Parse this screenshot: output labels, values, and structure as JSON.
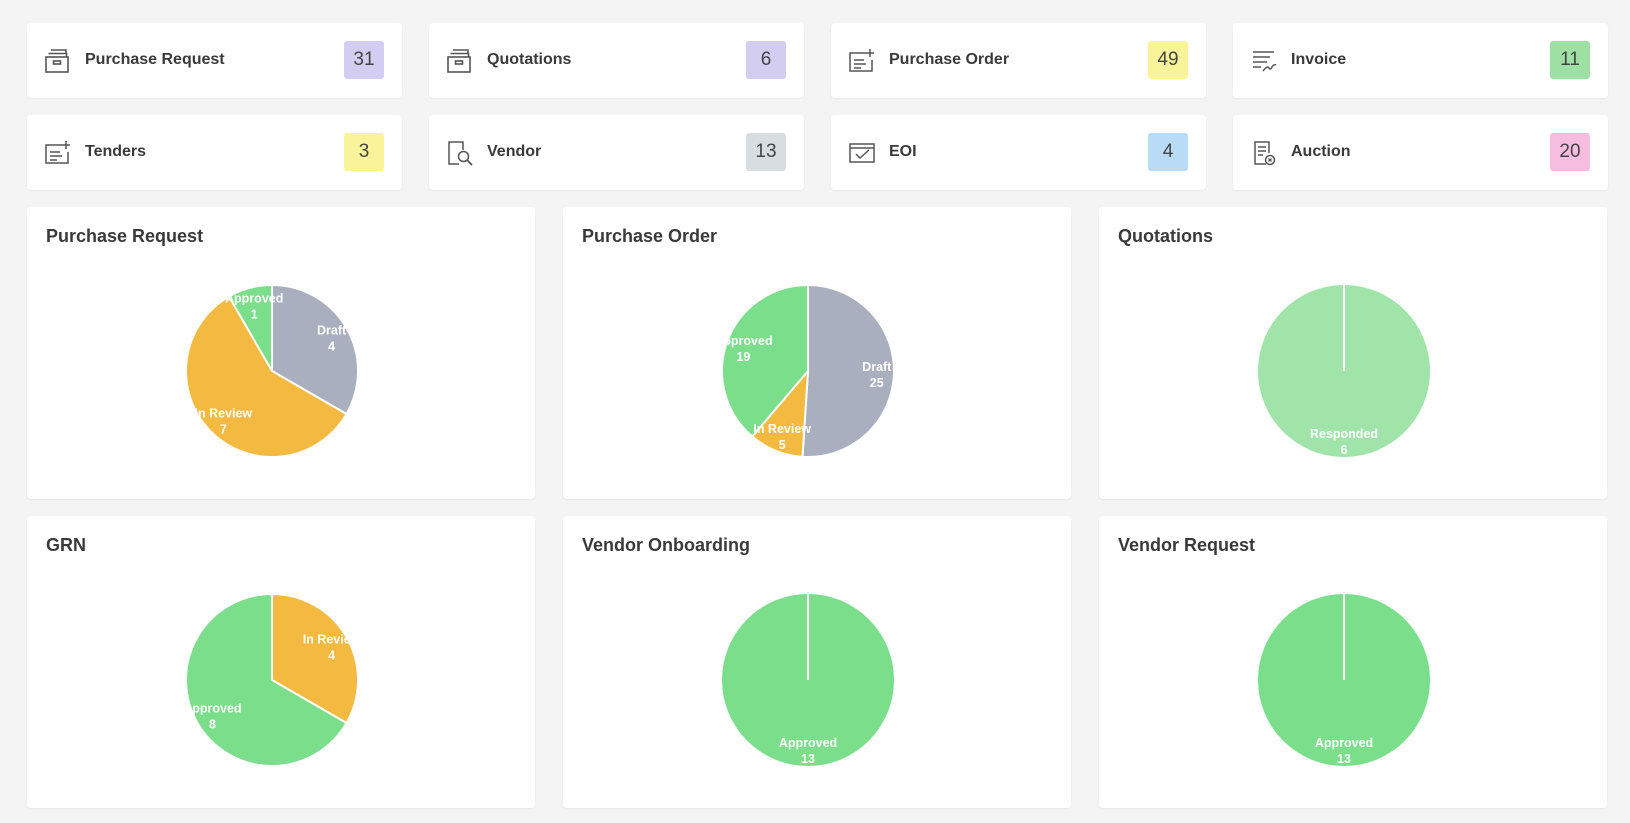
{
  "stats": [
    {
      "label": "Purchase Request",
      "count": "31",
      "icon": "archive-box-icon",
      "badge_color": "#d4cdf2"
    },
    {
      "label": "Quotations",
      "count": "6",
      "icon": "archive-box-icon",
      "badge_color": "#d4cdf2"
    },
    {
      "label": "Purchase Order",
      "count": "49",
      "icon": "add-document-icon",
      "badge_color": "#f9f39a"
    },
    {
      "label": "Invoice",
      "count": "11",
      "icon": "invoice-sign-icon",
      "badge_color": "#9ee0a3"
    },
    {
      "label": "Tenders",
      "count": "3",
      "icon": "add-document-icon",
      "badge_color": "#f9f39a"
    },
    {
      "label": "Vendor",
      "count": "13",
      "icon": "search-document-icon",
      "badge_color": "#d8dde1"
    },
    {
      "label": "EOI",
      "count": "4",
      "icon": "envelope-check-icon",
      "badge_color": "#b8dcf5"
    },
    {
      "label": "Auction",
      "count": "20",
      "icon": "auction-document-icon",
      "badge_color": "#f7bde0"
    }
  ],
  "colors": {
    "draft": "#aaafbf",
    "in_review": "#f4b940",
    "approved": "#7bde8a",
    "responded": "#a1e4a9"
  },
  "charts": [
    {
      "title": "Purchase Request"
    },
    {
      "title": "Purchase Order"
    },
    {
      "title": "Quotations"
    },
    {
      "title": "GRN"
    },
    {
      "title": "Vendor Onboarding"
    },
    {
      "title": "Vendor Request"
    }
  ],
  "chart_data": [
    {
      "type": "pie",
      "title": "Purchase Request",
      "labels": [
        "Draft",
        "In Review",
        "Approved"
      ],
      "values": [
        4,
        7,
        1
      ],
      "colors": [
        "#aaafbf",
        "#f4b940",
        "#7bde8a"
      ]
    },
    {
      "type": "pie",
      "title": "Purchase Order",
      "labels": [
        "Draft",
        "In Review",
        "Approved"
      ],
      "values": [
        25,
        5,
        19
      ],
      "colors": [
        "#aaafbf",
        "#f4b940",
        "#7bde8a"
      ]
    },
    {
      "type": "pie",
      "title": "Quotations",
      "labels": [
        "Responded"
      ],
      "values": [
        6
      ],
      "colors": [
        "#a1e4a9"
      ]
    },
    {
      "type": "pie",
      "title": "GRN",
      "labels": [
        "In Review",
        "Approved"
      ],
      "values": [
        4,
        8
      ],
      "colors": [
        "#f4b940",
        "#7bde8a"
      ]
    },
    {
      "type": "pie",
      "title": "Vendor Onboarding",
      "labels": [
        "Approved"
      ],
      "values": [
        13
      ],
      "colors": [
        "#7bde8a"
      ]
    },
    {
      "type": "pie",
      "title": "Vendor Request",
      "labels": [
        "Approved"
      ],
      "values": [
        13
      ],
      "colors": [
        "#7bde8a"
      ]
    }
  ]
}
